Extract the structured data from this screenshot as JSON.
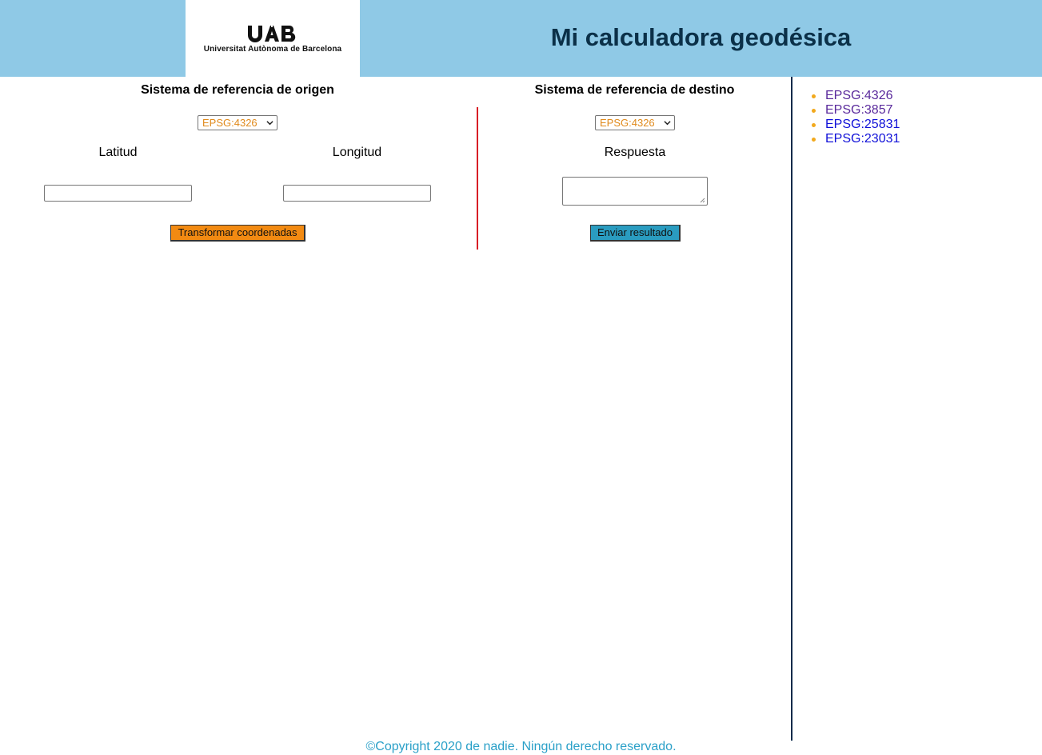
{
  "header": {
    "logo": {
      "mark": "UAB",
      "text": "Universitat Autònoma de Barcelona"
    },
    "title": "Mi calculadora geodésica"
  },
  "origin": {
    "title": "Sistema de referencia de origen",
    "select_value": "EPSG:4326",
    "latitude_label": "Latitud",
    "longitude_label": "Longitud",
    "latitude_value": "",
    "longitude_value": "",
    "button_label": "Transformar coordenadas"
  },
  "destination": {
    "title": "Sistema de referencia de destino",
    "select_value": "EPSG:4326",
    "response_label": "Respuesta",
    "response_value": "",
    "button_label": "Enviar resultado"
  },
  "sidebar": {
    "links": [
      {
        "label": "EPSG:4326",
        "state": "visited"
      },
      {
        "label": "EPSG:3857",
        "state": "visited"
      },
      {
        "label": "EPSG:25831",
        "state": "unvisited"
      },
      {
        "label": "EPSG:23031",
        "state": "unvisited"
      }
    ]
  },
  "footer": {
    "text": "©Copyright 2020 de nadie. Ningún derecho reservado."
  },
  "colors": {
    "header_bg": "#8fc9e6",
    "title": "#0b3048",
    "select_text": "#e08a1c",
    "button_orange": "#f28a12",
    "button_blue": "#2a9cc0",
    "divider_red": "#d81f26",
    "divider_navy": "#0b2a4a",
    "bullet": "#f2a91d",
    "link_visited": "#5a2a9c",
    "link_unvisited": "#1010d8",
    "footer_text": "#2aa0c8"
  }
}
